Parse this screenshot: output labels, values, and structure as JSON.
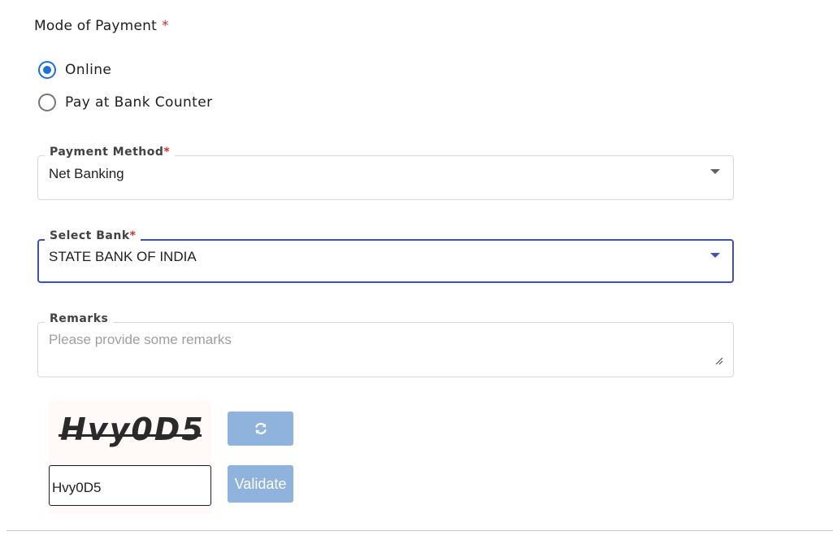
{
  "mode_of_payment": {
    "title": "Mode of Payment",
    "required_mark": "*",
    "options": [
      {
        "label": "Online",
        "checked": true
      },
      {
        "label": "Pay at Bank Counter",
        "checked": false
      }
    ]
  },
  "payment_method": {
    "label": "Payment Method",
    "required_mark": "*",
    "value": "Net Banking"
  },
  "select_bank": {
    "label": "Select Bank",
    "required_mark": "*",
    "value": "STATE BANK OF INDIA"
  },
  "remarks": {
    "label": "Remarks",
    "placeholder": "Please provide some remarks",
    "value": ""
  },
  "captcha": {
    "image_text": "Hvy0D5",
    "input_value": "Hvy0D5",
    "refresh_icon": "refresh-icon",
    "validate_label": "Validate"
  },
  "colors": {
    "accent": "#3f51b5",
    "radio_checked": "#1f6fd6",
    "required": "#d32f2f",
    "button": "#8fb3dc"
  }
}
